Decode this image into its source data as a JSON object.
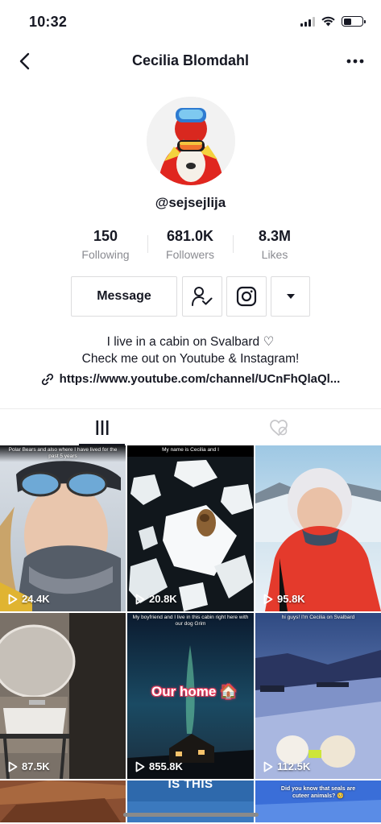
{
  "status_bar": {
    "time": "10:32"
  },
  "nav": {
    "title": "Cecilia Blomdahl"
  },
  "profile": {
    "username": "@sejsejlija",
    "stats": [
      {
        "value": "150",
        "label": "Following"
      },
      {
        "value": "681.0K",
        "label": "Followers"
      },
      {
        "value": "8.3M",
        "label": "Likes"
      }
    ],
    "message_label": "Message",
    "bio_line1": "I live in a cabin on Svalbard ♡",
    "bio_line2": "Check me out on Youtube & Instagram!",
    "link": "https://www.youtube.com/channel/UCnFhQlaQl..."
  },
  "videos": [
    {
      "views": "24.4K",
      "caption": "Polar Bears and also where I have lived for the past 5 years"
    },
    {
      "views": "20.8K",
      "caption": "My name is Cecilia and I"
    },
    {
      "views": "95.8K",
      "caption": ""
    },
    {
      "views": "87.5K",
      "caption": ""
    },
    {
      "views": "855.8K",
      "caption": "My boyfriend and I live in this cabin right here with our dog Grim",
      "overlay": "Our home 🏠"
    },
    {
      "views": "112.5K",
      "caption": "hi guys! I'm Cecilia on Svalbard"
    },
    {
      "views": "",
      "caption": ""
    },
    {
      "views": "",
      "caption": "",
      "overlay": "IS THIS"
    },
    {
      "views": "",
      "caption": "Did you know that seals are cuteer animals? 🥺"
    }
  ]
}
